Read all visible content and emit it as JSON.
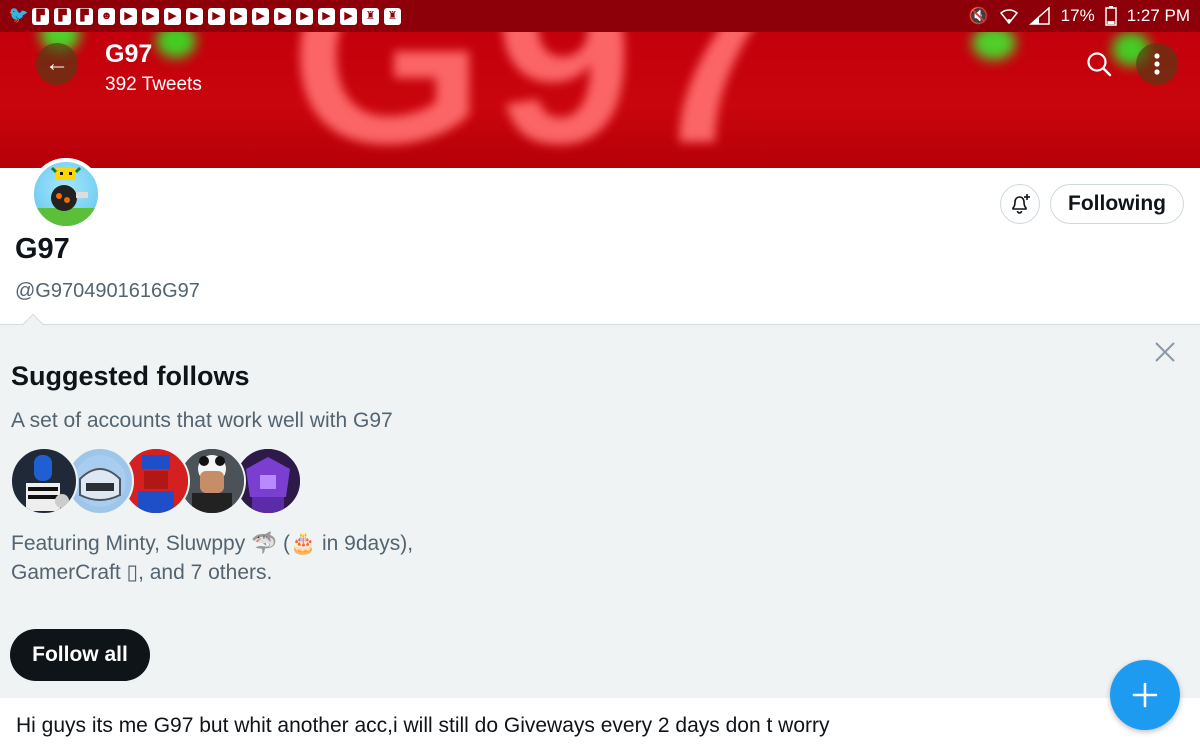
{
  "status_bar": {
    "left_icons": [
      "twitter-icon",
      "flipboard-icon",
      "flipboard-icon",
      "flipboard-icon",
      "game-icon",
      "youtube-icon",
      "youtube-icon",
      "youtube-icon",
      "youtube-icon",
      "youtube-icon",
      "youtube-icon",
      "youtube-icon",
      "youtube-icon",
      "youtube-icon",
      "youtube-icon",
      "youtube-icon",
      "game-icon",
      "game-icon"
    ],
    "battery": "17%",
    "time": "1:27 PM"
  },
  "header": {
    "title": "G97",
    "tweet_count": "392 Tweets"
  },
  "profile": {
    "name": "G97",
    "handle": "@G9704901616G97",
    "following_label": "Following"
  },
  "suggested": {
    "title": "Suggested follows",
    "description": "A set of accounts that work well with G97",
    "feature_line1": "Featuring Minty, Sluwppy 🦈 (🎂 in 9days),",
    "feature_line2": "GamerCraft ▯, and 7 others.",
    "follow_all_label": "Follow all"
  },
  "tweet": {
    "text": "Hi guys its me G97 but whit another acc,i will still do Giveways every 2 days don t worry"
  },
  "colors": {
    "banner_red": "#c3000c",
    "status_bar": "#8e0009",
    "fab_blue": "#1d9bf0",
    "panel_bg": "#eff3f4"
  }
}
